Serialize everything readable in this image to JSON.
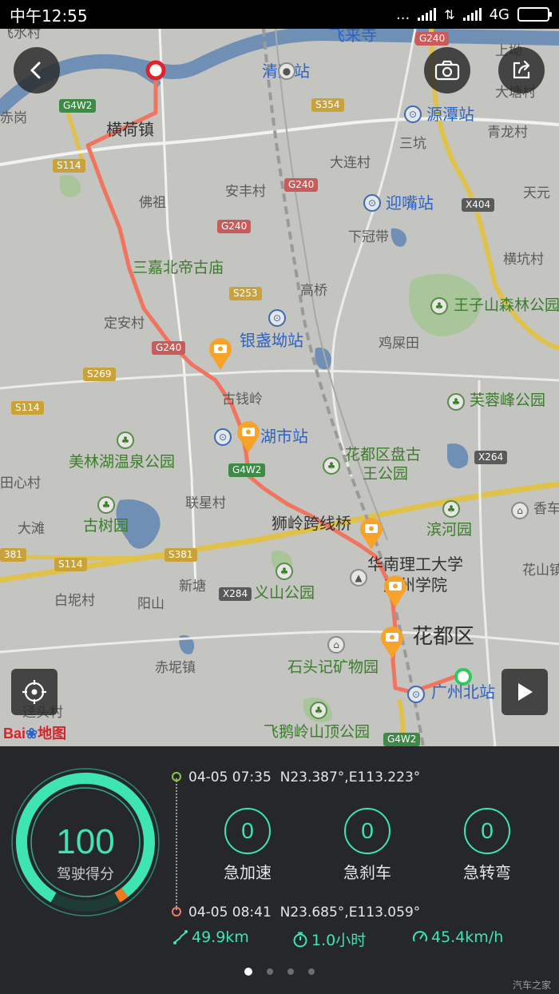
{
  "status_bar": {
    "time": "中午12:55",
    "dots": "...",
    "network": "4G"
  },
  "map": {
    "labels": {
      "qingyuan_station": "清远站",
      "hengheng_town": "横荷镇",
      "yuantan_station": "源潭站",
      "qinglong_village": "青龙村",
      "sankeng": "三坑",
      "dalian_village": "大连村",
      "anjian_village": "安丰村",
      "fozu": "佛祖",
      "yingzui_station": "迎嘴站",
      "xiaguandai": "下冠带",
      "tianyuan": "天元",
      "hengkeng_village": "横坑村",
      "sanjia_temple": "三嘉北帝古庙",
      "gaoqiao": "高桥",
      "wangzishan_park": "王子山森林公园",
      "dingan_village": "定安村",
      "yinzhan_station": "银盏坳站",
      "quepingtian": "鸡屎田",
      "guqianling": "古钱岭",
      "furongfeng_park": "芙蓉峰公园",
      "shihu_station": "湖市站",
      "meilinhu_park": "美林湖温泉公园",
      "huadu_wangpark_1": "花都区盘古",
      "huadu_wangpark_2": "王公园",
      "tianxin_village": "田心村",
      "lianxing_village": "联星村",
      "xianghe": "香车",
      "dawei": "大滩",
      "gushu_park": "古树园",
      "shiling_bridge": "狮岭跨线桥",
      "binhe_park": "滨河园",
      "scut_1": "华南理工大学",
      "scut_2": "广州学院",
      "huashan": "花山镇",
      "baini_village": "白坭村",
      "yangshan": "阳山",
      "xintang": "新塘",
      "yishan_park": "义山公园",
      "huadu_district": "花都区",
      "chini_town": "赤坭镇",
      "shitouji_museum": "石头记矿物园",
      "guangzhou_north": "广州北站",
      "xinhua_village": "迳头村",
      "feieling_park": "飞鹅岭山顶公园",
      "top_village": "飞水村",
      "top_temple": "飞来寺",
      "shanglai": "上坳",
      "datang": "大塘村",
      "chigang": "赤岗"
    },
    "shields": {
      "g4w2_top": "G4W2",
      "g240_top": "G240",
      "s354": "S354",
      "s114_a": "S114",
      "g240_mid": "G240",
      "x404": "X404",
      "g240_b": "G240",
      "s253": "S253",
      "g240_c": "G240",
      "s269": "S269",
      "s114_b": "S114",
      "g4w2_mid": "G4W2",
      "x264": "X264",
      "s381_a": "381",
      "s381_b": "S381",
      "s114_c": "S114",
      "x284": "X284",
      "g4w2_bot": "G4W2"
    },
    "logo": "Bai地图",
    "colors": {
      "route": "#f0745e",
      "water": "#6f8fb5",
      "park": "#a9c59a",
      "start": "#e0222a",
      "end": "#2fc85a"
    }
  },
  "buttons": {
    "back_icon": "chevron-left-icon",
    "camera_icon": "camera-icon",
    "share_icon": "share-icon",
    "locate_icon": "locate-icon",
    "play_icon": "play-icon"
  },
  "trip": {
    "score": "100",
    "score_label": "驾驶得分",
    "score_fraction": 1.0,
    "start": {
      "time": "04-05 07:35",
      "coords": "N23.387°,E113.223°"
    },
    "end": {
      "time": "04-05 08:41",
      "coords": "N23.685°,E113.059°"
    },
    "events": [
      {
        "value": "0",
        "label": "急加速"
      },
      {
        "value": "0",
        "label": "急刹车"
      },
      {
        "value": "0",
        "label": "急转弯"
      }
    ],
    "distance": "49.9km",
    "duration": "1.0小时",
    "speed": "45.4km/h",
    "page_indicator": {
      "pages": 4,
      "current": 1
    },
    "watermark": "汽车之家"
  }
}
